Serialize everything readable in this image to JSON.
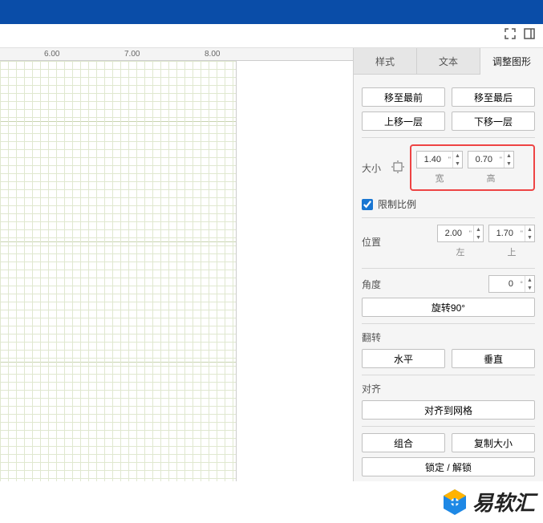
{
  "ruler": {
    "t1": "6.00",
    "t2": "7.00",
    "t3": "8.00"
  },
  "tabs": {
    "style": "样式",
    "text": "文本",
    "arrange": "调整图形"
  },
  "arrange": {
    "toFront": "移至最前",
    "toBack": "移至最后",
    "forward": "上移一层",
    "backward": "下移一层"
  },
  "size": {
    "label": "大小",
    "widthVal": "1.40",
    "widthUnit": "\"",
    "widthLabel": "宽",
    "heightVal": "0.70",
    "heightUnit": "\"",
    "heightLabel": "高",
    "constrain": "限制比例"
  },
  "position": {
    "label": "位置",
    "leftVal": "2.00",
    "leftUnit": "\"",
    "leftLabel": "左",
    "topVal": "1.70",
    "topUnit": "\"",
    "topLabel": "上"
  },
  "angle": {
    "label": "角度",
    "val": "0",
    "unit": "°",
    "rotate90": "旋转90°"
  },
  "flip": {
    "label": "翻转",
    "horiz": "水平",
    "vert": "垂直"
  },
  "align": {
    "label": "对齐",
    "snap": "对齐到网格"
  },
  "misc": {
    "group": "组合",
    "copySize": "复制大小",
    "lock": "锁定 / 解锁"
  },
  "watermark": "易软汇"
}
